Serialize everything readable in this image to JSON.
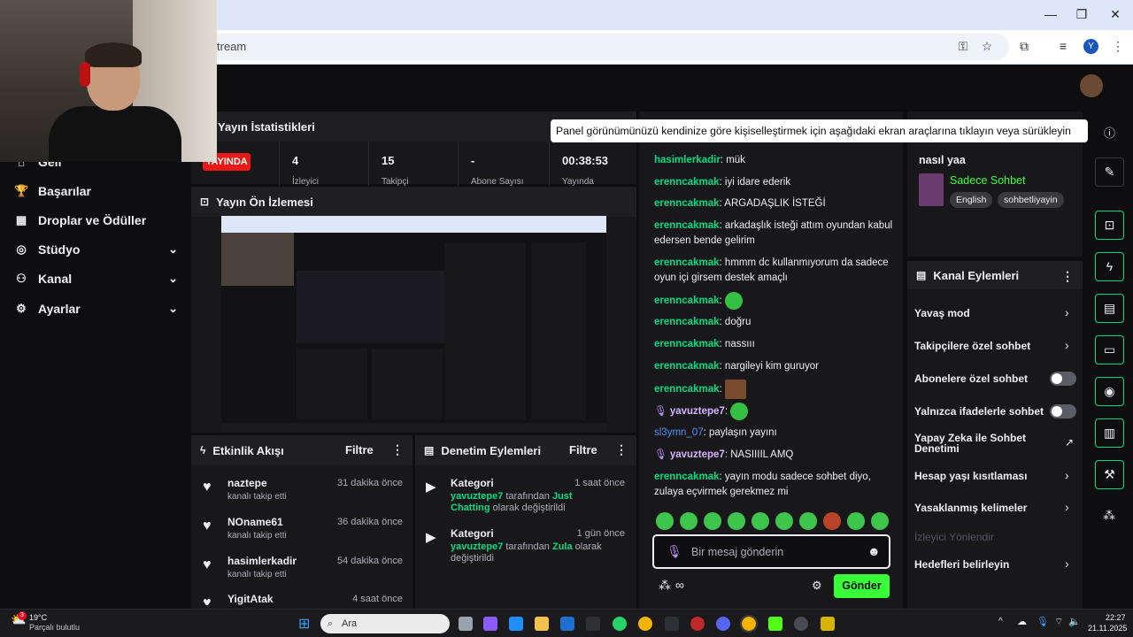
{
  "browser": {
    "url": "tream",
    "profile_initial": "Y"
  },
  "nav": {
    "items": [
      {
        "label": "Geli"
      },
      {
        "label": "Başarılar"
      },
      {
        "label": "Droplar ve Ödüller"
      },
      {
        "label": "Stüdyo"
      },
      {
        "label": "Kanal"
      },
      {
        "label": "Ayarlar"
      }
    ]
  },
  "stats": {
    "title": "Yayın İstatistikleri",
    "live_badge": "YAYINDA",
    "cells": [
      {
        "value": "4",
        "label": "İzleyici"
      },
      {
        "value": "15",
        "label": "Takipçi"
      },
      {
        "value": "-",
        "label": "Abone Sayısı"
      },
      {
        "value": "00:38:53",
        "label": "Yayında"
      }
    ]
  },
  "preview": {
    "title": "Yayın Ön İzlemesi"
  },
  "activity": {
    "title": "Etkinlik Akışı",
    "filter": "Filtre",
    "items": [
      {
        "name": "naztepe",
        "sub": "kanalı takip etti",
        "time": "31 dakika önce"
      },
      {
        "name": "NOname61",
        "sub": "kanalı takip etti",
        "time": "36 dakika önce"
      },
      {
        "name": "hasimlerkadir",
        "sub": "kanalı takip etti",
        "time": "54 dakika önce"
      },
      {
        "name": "YigitAtak",
        "sub": "",
        "time": "4 saat önce"
      }
    ]
  },
  "moderation": {
    "title": "Denetim Eylemleri",
    "filter": "Filtre",
    "items": [
      {
        "title": "Kategori",
        "time": "1 saat önce",
        "user": "yavuztepe7",
        "mid": " tarafından ",
        "value": "Just Chatting",
        "end": " olarak değiştirildi"
      },
      {
        "title": "Kategori",
        "time": "1 gün önce",
        "user": "yavuztepe7",
        "mid": " tarafından ",
        "value": "Zula",
        "end": " olarak değiştirildi"
      }
    ]
  },
  "chat": {
    "messages": [
      {
        "user": "hasimlerkadir",
        "text": "mük"
      },
      {
        "user": "erenncakmak",
        "text": "iyi idare ederik"
      },
      {
        "user": "erenncakmak",
        "text": "ARGADAŞLIK İSTEĞİ"
      },
      {
        "user": "erenncakmak",
        "text": "arkadaşlık isteği attım oyundan kabul edersen bende gelirim"
      },
      {
        "user": "erenncakmak",
        "text": "hmmm dc kullanmıyorum da sadece oyun içi girsem destek amaçlı"
      },
      {
        "user": "erenncakmak",
        "text": ""
      },
      {
        "user": "erenncakmak",
        "text": "doğru"
      },
      {
        "user": "erenncakmak",
        "text": "nassııı"
      },
      {
        "user": "erenncakmak",
        "text": "nargileyi kim guruyor"
      },
      {
        "user": "erenncakmak",
        "text": ""
      },
      {
        "user": "yavuztepe7",
        "text": ""
      },
      {
        "user": "sl3ymn_07",
        "text": "paylaşın yayını"
      },
      {
        "user": "yavuztepe7",
        "text": "NASIIIIL AMQ"
      },
      {
        "user": "erenncakmak",
        "text": "yayın modu sadece sohbet diyo, zulaya eçvirmek gerekmez mi"
      }
    ],
    "input_placeholder": "Bir mesaj gönderin",
    "send_label": "Gönder"
  },
  "stream_info": {
    "title": "nasıl yaa",
    "category": "Sadece Sohbet",
    "tags": [
      "English",
      "sohbetliyayin"
    ]
  },
  "channel_actions": {
    "title": "Kanal Eylemleri",
    "items": [
      {
        "label": "Yavaş mod",
        "control": "chevron"
      },
      {
        "label": "Takipçilere özel sohbet",
        "control": "chevron"
      },
      {
        "label": "Abonelere özel sohbet",
        "control": "toggle"
      },
      {
        "label": "Yalnızca ifadelerle sohbet",
        "control": "toggle"
      },
      {
        "label": "Yapay Zeka ile Sohbet Denetimi",
        "control": "external"
      },
      {
        "label": "Hesap yaşı kısıtlaması",
        "control": "chevron"
      },
      {
        "label": "Yasaklanmış kelimeler",
        "control": "chevron"
      },
      {
        "label": "İzleyici Yönlendir",
        "control": "none"
      },
      {
        "label": "Hedefleri belirleyin",
        "control": "chevron"
      }
    ]
  },
  "tooltip": "Panel görünümünüzü kendinize göre kişiselleştirmek için aşağıdaki ekran araçlarına tıklayın veya sürükleyin",
  "taskbar": {
    "weather_temp": "19°C",
    "weather_desc": "Parçalı bulutlu",
    "search_placeholder": "Ara",
    "time": "22:27",
    "date": "21.11.2025",
    "notification_count": "3"
  },
  "colors": {
    "accent": "#00db84",
    "send": "#38ff38",
    "live": "#e91916",
    "panel": "#18181b"
  }
}
